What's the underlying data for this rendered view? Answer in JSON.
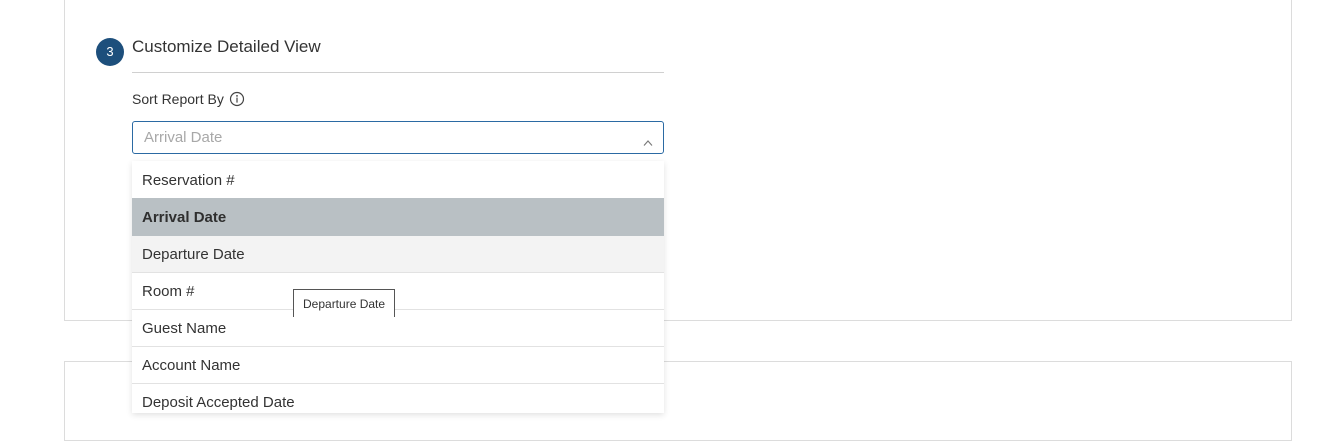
{
  "section": {
    "step_number": "3",
    "title": "Customize Detailed View"
  },
  "sort_field": {
    "label": "Sort Report By",
    "label_icon": "info-icon",
    "selected_value": "Arrival Date",
    "expanded": true,
    "chevron_icon": "chevron-up-icon"
  },
  "dropdown": {
    "options": [
      {
        "label": "Reservation #",
        "state": "normal"
      },
      {
        "label": "Arrival Date",
        "state": "selected"
      },
      {
        "label": "Departure Date",
        "state": "hovered"
      },
      {
        "label": "Room #",
        "state": "normal"
      },
      {
        "label": "Guest Name",
        "state": "normal"
      },
      {
        "label": "Account Name",
        "state": "normal"
      },
      {
        "label": "Deposit Accepted Date",
        "state": "normal"
      }
    ]
  },
  "tooltip": {
    "text": "Departure Date"
  },
  "colors": {
    "badge": "#1d4f7c",
    "select_border": "#2b6aa3",
    "selected_option_bg": "#b9c0c4",
    "hovered_option_bg": "#f3f3f3"
  }
}
